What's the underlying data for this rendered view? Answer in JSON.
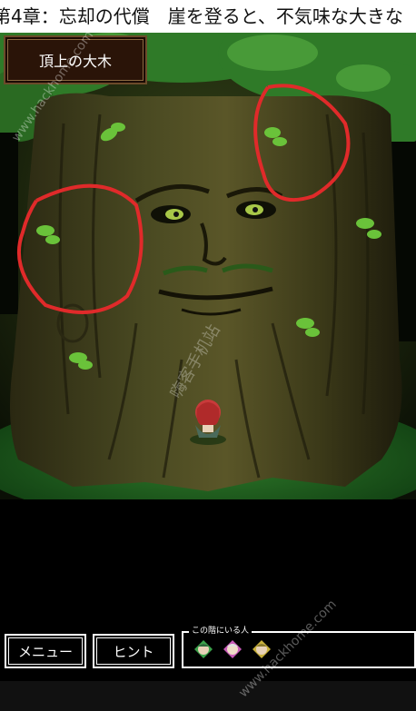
{
  "header": {
    "ticker_text": "第4章：忘却の代償　崖を登ると、不気味な大きな"
  },
  "scene": {
    "location_name": "頂上の大木"
  },
  "bottom_bar": {
    "menu_label": "メニュー",
    "hint_label": "ヒント",
    "party_label": "この階にいる人"
  },
  "watermarks": [
    "www.hackhome.com",
    "嗨客手机站"
  ]
}
